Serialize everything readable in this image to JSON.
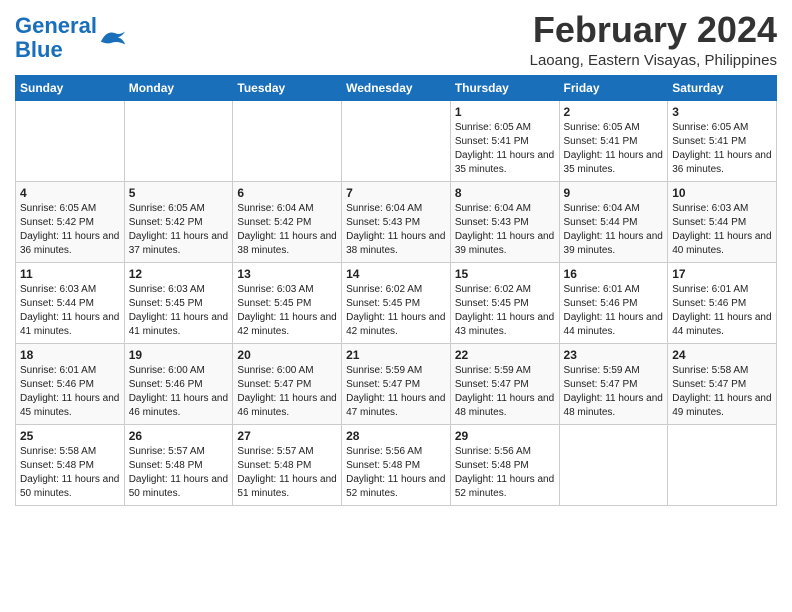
{
  "app": {
    "name": "GeneralBlue"
  },
  "title": "February 2024",
  "location": "Laoang, Eastern Visayas, Philippines",
  "days_of_week": [
    "Sunday",
    "Monday",
    "Tuesday",
    "Wednesday",
    "Thursday",
    "Friday",
    "Saturday"
  ],
  "weeks": [
    [
      {
        "day": "",
        "sunrise": "",
        "sunset": "",
        "daylight": ""
      },
      {
        "day": "",
        "sunrise": "",
        "sunset": "",
        "daylight": ""
      },
      {
        "day": "",
        "sunrise": "",
        "sunset": "",
        "daylight": ""
      },
      {
        "day": "",
        "sunrise": "",
        "sunset": "",
        "daylight": ""
      },
      {
        "day": "1",
        "sunrise": "Sunrise: 6:05 AM",
        "sunset": "Sunset: 5:41 PM",
        "daylight": "Daylight: 11 hours and 35 minutes."
      },
      {
        "day": "2",
        "sunrise": "Sunrise: 6:05 AM",
        "sunset": "Sunset: 5:41 PM",
        "daylight": "Daylight: 11 hours and 35 minutes."
      },
      {
        "day": "3",
        "sunrise": "Sunrise: 6:05 AM",
        "sunset": "Sunset: 5:41 PM",
        "daylight": "Daylight: 11 hours and 36 minutes."
      }
    ],
    [
      {
        "day": "4",
        "sunrise": "Sunrise: 6:05 AM",
        "sunset": "Sunset: 5:42 PM",
        "daylight": "Daylight: 11 hours and 36 minutes."
      },
      {
        "day": "5",
        "sunrise": "Sunrise: 6:05 AM",
        "sunset": "Sunset: 5:42 PM",
        "daylight": "Daylight: 11 hours and 37 minutes."
      },
      {
        "day": "6",
        "sunrise": "Sunrise: 6:04 AM",
        "sunset": "Sunset: 5:42 PM",
        "daylight": "Daylight: 11 hours and 38 minutes."
      },
      {
        "day": "7",
        "sunrise": "Sunrise: 6:04 AM",
        "sunset": "Sunset: 5:43 PM",
        "daylight": "Daylight: 11 hours and 38 minutes."
      },
      {
        "day": "8",
        "sunrise": "Sunrise: 6:04 AM",
        "sunset": "Sunset: 5:43 PM",
        "daylight": "Daylight: 11 hours and 39 minutes."
      },
      {
        "day": "9",
        "sunrise": "Sunrise: 6:04 AM",
        "sunset": "Sunset: 5:44 PM",
        "daylight": "Daylight: 11 hours and 39 minutes."
      },
      {
        "day": "10",
        "sunrise": "Sunrise: 6:03 AM",
        "sunset": "Sunset: 5:44 PM",
        "daylight": "Daylight: 11 hours and 40 minutes."
      }
    ],
    [
      {
        "day": "11",
        "sunrise": "Sunrise: 6:03 AM",
        "sunset": "Sunset: 5:44 PM",
        "daylight": "Daylight: 11 hours and 41 minutes."
      },
      {
        "day": "12",
        "sunrise": "Sunrise: 6:03 AM",
        "sunset": "Sunset: 5:45 PM",
        "daylight": "Daylight: 11 hours and 41 minutes."
      },
      {
        "day": "13",
        "sunrise": "Sunrise: 6:03 AM",
        "sunset": "Sunset: 5:45 PM",
        "daylight": "Daylight: 11 hours and 42 minutes."
      },
      {
        "day": "14",
        "sunrise": "Sunrise: 6:02 AM",
        "sunset": "Sunset: 5:45 PM",
        "daylight": "Daylight: 11 hours and 42 minutes."
      },
      {
        "day": "15",
        "sunrise": "Sunrise: 6:02 AM",
        "sunset": "Sunset: 5:45 PM",
        "daylight": "Daylight: 11 hours and 43 minutes."
      },
      {
        "day": "16",
        "sunrise": "Sunrise: 6:01 AM",
        "sunset": "Sunset: 5:46 PM",
        "daylight": "Daylight: 11 hours and 44 minutes."
      },
      {
        "day": "17",
        "sunrise": "Sunrise: 6:01 AM",
        "sunset": "Sunset: 5:46 PM",
        "daylight": "Daylight: 11 hours and 44 minutes."
      }
    ],
    [
      {
        "day": "18",
        "sunrise": "Sunrise: 6:01 AM",
        "sunset": "Sunset: 5:46 PM",
        "daylight": "Daylight: 11 hours and 45 minutes."
      },
      {
        "day": "19",
        "sunrise": "Sunrise: 6:00 AM",
        "sunset": "Sunset: 5:46 PM",
        "daylight": "Daylight: 11 hours and 46 minutes."
      },
      {
        "day": "20",
        "sunrise": "Sunrise: 6:00 AM",
        "sunset": "Sunset: 5:47 PM",
        "daylight": "Daylight: 11 hours and 46 minutes."
      },
      {
        "day": "21",
        "sunrise": "Sunrise: 5:59 AM",
        "sunset": "Sunset: 5:47 PM",
        "daylight": "Daylight: 11 hours and 47 minutes."
      },
      {
        "day": "22",
        "sunrise": "Sunrise: 5:59 AM",
        "sunset": "Sunset: 5:47 PM",
        "daylight": "Daylight: 11 hours and 48 minutes."
      },
      {
        "day": "23",
        "sunrise": "Sunrise: 5:59 AM",
        "sunset": "Sunset: 5:47 PM",
        "daylight": "Daylight: 11 hours and 48 minutes."
      },
      {
        "day": "24",
        "sunrise": "Sunrise: 5:58 AM",
        "sunset": "Sunset: 5:47 PM",
        "daylight": "Daylight: 11 hours and 49 minutes."
      }
    ],
    [
      {
        "day": "25",
        "sunrise": "Sunrise: 5:58 AM",
        "sunset": "Sunset: 5:48 PM",
        "daylight": "Daylight: 11 hours and 50 minutes."
      },
      {
        "day": "26",
        "sunrise": "Sunrise: 5:57 AM",
        "sunset": "Sunset: 5:48 PM",
        "daylight": "Daylight: 11 hours and 50 minutes."
      },
      {
        "day": "27",
        "sunrise": "Sunrise: 5:57 AM",
        "sunset": "Sunset: 5:48 PM",
        "daylight": "Daylight: 11 hours and 51 minutes."
      },
      {
        "day": "28",
        "sunrise": "Sunrise: 5:56 AM",
        "sunset": "Sunset: 5:48 PM",
        "daylight": "Daylight: 11 hours and 52 minutes."
      },
      {
        "day": "29",
        "sunrise": "Sunrise: 5:56 AM",
        "sunset": "Sunset: 5:48 PM",
        "daylight": "Daylight: 11 hours and 52 minutes."
      },
      {
        "day": "",
        "sunrise": "",
        "sunset": "",
        "daylight": ""
      },
      {
        "day": "",
        "sunrise": "",
        "sunset": "",
        "daylight": ""
      }
    ]
  ]
}
